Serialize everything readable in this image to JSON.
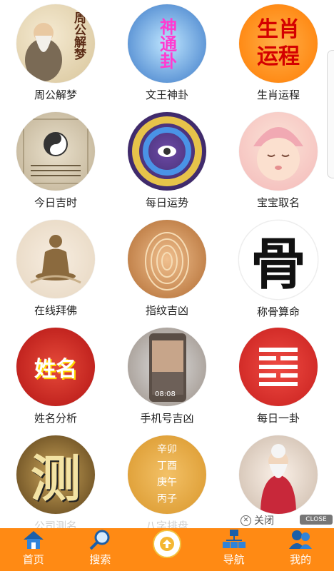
{
  "items": [
    {
      "label": "周公解梦",
      "icon": "zhougong-dream-icon",
      "art": "周公解梦"
    },
    {
      "label": "文王神卦",
      "icon": "wenwang-divination-icon",
      "art": "神通卦"
    },
    {
      "label": "生肖运程",
      "icon": "zodiac-fortune-icon",
      "art": "生肖运程"
    },
    {
      "label": "今日吉时",
      "icon": "lucky-time-icon",
      "art": ""
    },
    {
      "label": "每日运势",
      "icon": "daily-fortune-icon",
      "art": ""
    },
    {
      "label": "宝宝取名",
      "icon": "baby-naming-icon",
      "art": ""
    },
    {
      "label": "在线拜佛",
      "icon": "buddha-icon",
      "art": ""
    },
    {
      "label": "指纹吉凶",
      "icon": "fingerprint-icon",
      "art": ""
    },
    {
      "label": "称骨算命",
      "icon": "bone-weight-icon",
      "art": "骨"
    },
    {
      "label": "姓名分析",
      "icon": "name-analysis-icon",
      "art": "姓名"
    },
    {
      "label": "手机号吉凶",
      "icon": "phone-number-icon",
      "art": "08:08"
    },
    {
      "label": "每日一卦",
      "icon": "hexagram-icon",
      "art": ""
    },
    {
      "label": "公司测名",
      "icon": "company-naming-icon",
      "art": "测"
    },
    {
      "label": "八字排盘",
      "icon": "bazi-icon",
      "art": "辛卯 丁酉 庚午 丙子"
    },
    {
      "label": "",
      "icon": "elder-icon",
      "art": ""
    }
  ],
  "ad": {
    "close_text": "关闭",
    "close_tag": "CLOSE"
  },
  "tabs": [
    {
      "label": "首页",
      "icon": "home-icon"
    },
    {
      "label": "搜索",
      "icon": "search-icon"
    },
    {
      "label": "",
      "icon": "up-arrow-icon"
    },
    {
      "label": "导航",
      "icon": "sitemap-icon"
    },
    {
      "label": "我的",
      "icon": "user-icon"
    }
  ],
  "colors": {
    "tabbar": "#ff8a14"
  }
}
